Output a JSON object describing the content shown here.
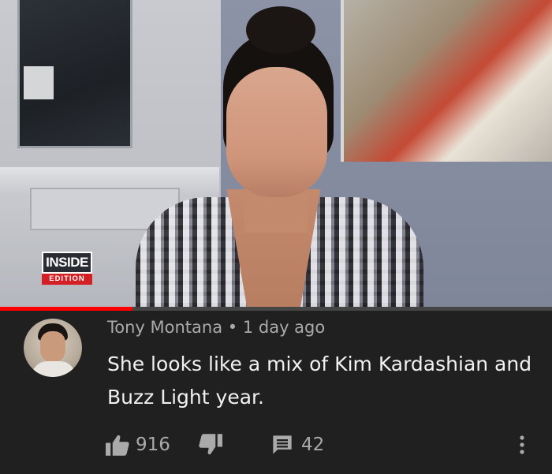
{
  "video": {
    "logo_top": "INSIDE",
    "logo_bottom": "EDITION",
    "progress": 0.24
  },
  "comment": {
    "author": "Tony Montana",
    "separator": "•",
    "time": "1 day ago",
    "text": "She looks like a mix of Kim Kardashian and Buzz Light year.",
    "likes": "916",
    "replies": "42"
  },
  "icons": {
    "like": "thumbs-up-icon",
    "dislike": "thumbs-down-icon",
    "reply": "comment-icon",
    "more": "more-vert-icon"
  },
  "colors": {
    "background": "#202020",
    "progress": "#ff0000",
    "meta_text": "#aaaaaa",
    "body_text": "#f1f1f1",
    "logo_red": "#d41f24"
  }
}
